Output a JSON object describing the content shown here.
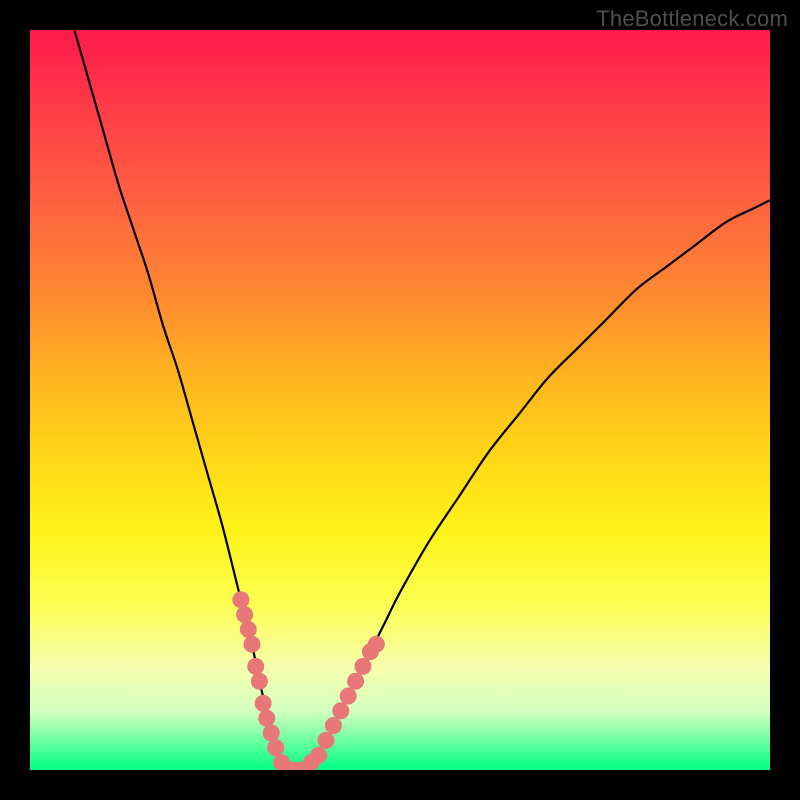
{
  "watermark": "TheBottleneck.com",
  "colors": {
    "curve_stroke": "#000000",
    "marker_fill": "#e87878",
    "marker_stroke": "#e87878",
    "background_black": "#000000"
  },
  "chart_data": {
    "type": "line",
    "title": "",
    "xlabel": "",
    "ylabel": "",
    "xlim": [
      0,
      100
    ],
    "ylim": [
      0,
      100
    ],
    "grid": false,
    "legend": false,
    "series": [
      {
        "name": "bottleneck-curve",
        "x": [
          6,
          8,
          10,
          12,
          14,
          16,
          18,
          20,
          22,
          24,
          26,
          28,
          29,
          30,
          31,
          32,
          33,
          34,
          35,
          36,
          37,
          38,
          40,
          42,
          44,
          46,
          48,
          50,
          54,
          58,
          62,
          66,
          70,
          74,
          78,
          82,
          86,
          90,
          94,
          98,
          100
        ],
        "values": [
          100,
          93,
          86,
          79,
          73,
          67,
          60,
          54,
          47,
          40,
          33,
          25,
          21,
          17,
          12,
          8,
          4,
          1,
          0,
          0,
          0,
          1,
          4,
          8,
          12,
          16,
          20,
          24,
          31,
          37,
          43,
          48,
          53,
          57,
          61,
          65,
          68,
          71,
          74,
          76,
          77
        ]
      },
      {
        "name": "markers",
        "x": [
          28.5,
          29.0,
          29.5,
          30.0,
          30.5,
          31.0,
          31.5,
          32.0,
          32.6,
          33.2,
          34.0,
          35.0,
          36.0,
          37.0,
          38.0,
          39.0,
          40.0,
          41.0,
          42.0,
          43.0,
          44.0,
          45.0,
          46.0,
          46.8
        ],
        "values": [
          23,
          21,
          19,
          17,
          14,
          12,
          9,
          7,
          5,
          3,
          1,
          0,
          0,
          0,
          1,
          2,
          4,
          6,
          8,
          10,
          12,
          14,
          16,
          17
        ]
      }
    ]
  }
}
